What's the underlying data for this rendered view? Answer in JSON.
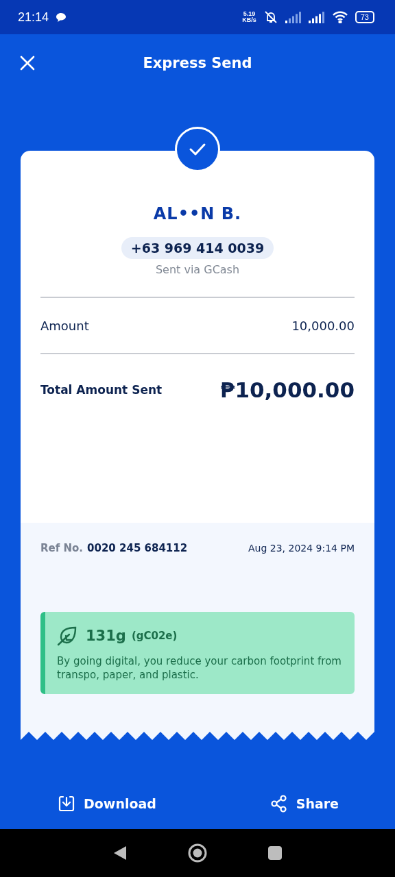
{
  "status_bar": {
    "time": "21:14",
    "speed": "5.19",
    "speed_unit": "KB/s",
    "battery": "73"
  },
  "header": {
    "title": "Express Send"
  },
  "recipient": {
    "name": "AL••N B.",
    "phone": "+63 969 414 0039",
    "via": "Sent via GCash"
  },
  "amount": {
    "label": "Amount",
    "value": "10,000.00"
  },
  "total": {
    "label": "Total Amount Sent",
    "value": "₱10,000.00"
  },
  "reference": {
    "label": "Ref No.",
    "number": "0020 245 684112",
    "date": "Aug 23, 2024 9:14 PM"
  },
  "eco": {
    "value": "131g",
    "unit": "(gC02e)",
    "text": "By going digital, you reduce your carbon footprint from transpo, paper, and plastic."
  },
  "actions": [
    {
      "kind": "download",
      "label": "Download"
    },
    {
      "kind": "share",
      "label": "Share"
    }
  ]
}
